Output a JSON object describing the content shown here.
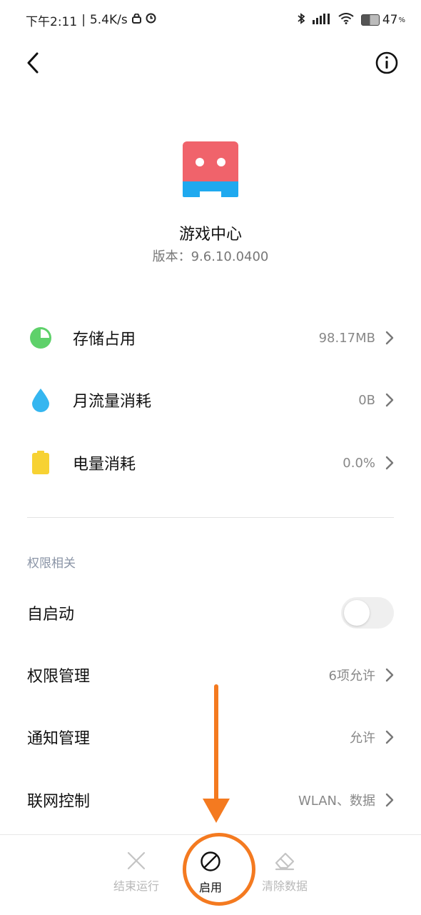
{
  "status_bar": {
    "time": "下午2:11",
    "speed": "5.4K/s",
    "battery": "47",
    "battery_unit": "%"
  },
  "app": {
    "name": "游戏中心",
    "version": "版本：9.6.10.0400"
  },
  "usage": [
    {
      "label": "存储占用",
      "value": "98.17MB",
      "icon": "pie-chart-icon",
      "color": "#5ed16a"
    },
    {
      "label": "月流量消耗",
      "value": "0B",
      "icon": "water-drop-icon",
      "color": "#35b6f0"
    },
    {
      "label": "电量消耗",
      "value": "0.0%",
      "icon": "battery-icon",
      "color": "#f7d233"
    }
  ],
  "permissions": {
    "section_title": "权限相关",
    "autostart_label": "自启动",
    "autostart_on": false,
    "items": [
      {
        "label": "权限管理",
        "value": "6项允许"
      },
      {
        "label": "通知管理",
        "value": "允许"
      },
      {
        "label": "联网控制",
        "value": "WLAN、数据"
      }
    ]
  },
  "bottom_bar": {
    "stop": "结束运行",
    "enable": "启用",
    "clear": "清除数据"
  },
  "colors": {
    "annotation": "#f47a20",
    "app_icon_top": "#f0636b",
    "app_icon_bottom": "#1fa9ef"
  }
}
